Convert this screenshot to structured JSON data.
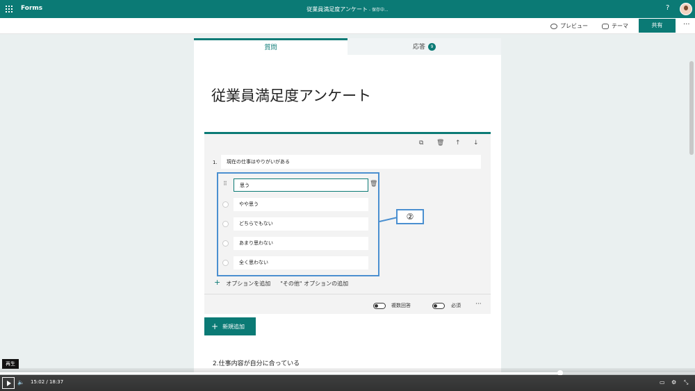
{
  "topbar": {
    "app_name": "Forms",
    "doc_title": "従業員満足度アンケート",
    "saving": " - 保存中...",
    "help": "?"
  },
  "toolbar": {
    "preview": "プレビュー",
    "theme": "テーマ",
    "share": "共有",
    "more": "···"
  },
  "tabs": {
    "questions": "質問",
    "responses": "応答",
    "response_count": "9"
  },
  "form": {
    "title": "従業員満足度アンケート"
  },
  "question1": {
    "number": "1.",
    "text": "現在の仕事はやりがいがある",
    "options": [
      "思う",
      "やや思う",
      "どちらでもない",
      "あまり思わない",
      "全く思わない"
    ],
    "add_option": "オプションを追加",
    "add_other": "\"その他\" オプションの追加",
    "multiple_answers": "複数回答",
    "required": "必須",
    "more": "···"
  },
  "callout": {
    "label": "②"
  },
  "add_new": {
    "label": "新規追加"
  },
  "question2": {
    "title": "2.仕事内容が自分に合っている"
  },
  "video": {
    "tooltip": "再生",
    "time": "15:02 / 18:37",
    "progress": 0.806
  }
}
